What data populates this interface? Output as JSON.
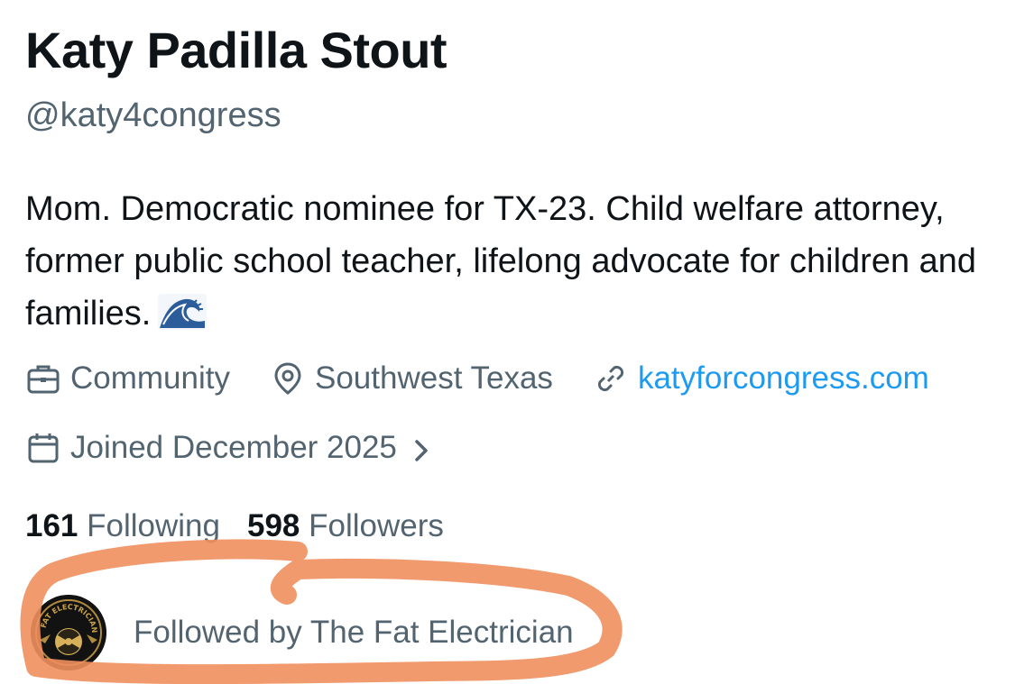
{
  "profile": {
    "display_name": "Katy Padilla Stout",
    "handle": "@katy4congress",
    "bio": "Mom. Democratic nominee for TX-23. Child welfare attorney, former public school teacher, lifelong advocate for children and families."
  },
  "meta": {
    "category": "Community",
    "location": "Southwest Texas",
    "website": "katyforcongress.com",
    "joined": "Joined December 2025"
  },
  "stats": {
    "following_count": "161",
    "following_label": "Following",
    "followers_count": "598",
    "followers_label": "Followers"
  },
  "followed_by": {
    "text": "Followed by The Fat Electrician",
    "avatar_text": "FAT ELECTRICIAN"
  },
  "colors": {
    "text_primary": "#0f1419",
    "text_secondary": "#536471",
    "link": "#1d9bf0",
    "highlight": "#ef8f5e"
  },
  "icons": [
    "briefcase-icon",
    "location-pin-icon",
    "link-icon",
    "calendar-icon",
    "chevron-right-icon",
    "wave-emoji"
  ]
}
